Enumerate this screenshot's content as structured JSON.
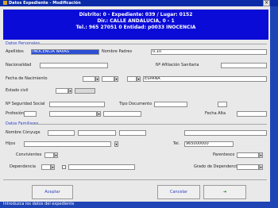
{
  "window": {
    "title": "Datos Expediente - Modificación"
  },
  "header": {
    "line1": "Distrito: 0 - Expediente: 039 / Lugar: 0152",
    "line2": "Dir.: CALLE ANDALUCIA, 0 - 1",
    "line3": "Tel.: 965 27051 0  Entidad: p0033 INOCENCIA"
  },
  "section1": {
    "title": "Datos Personales"
  },
  "row1": {
    "label_a": "Apellidos",
    "value_a": "INOCENCIA NAVAS",
    "label_b": "Nombre Padres",
    "value_b": "0.10"
  },
  "row2": {
    "label_a": "Nacionalidad",
    "value_a": "",
    "label_b": "Nº Afiliación Sanitaria",
    "value_b": ""
  },
  "row3": {
    "label_a": "Fecha de Nacimiento",
    "value_a": "",
    "field2": "",
    "field3": "",
    "value_b": "ESPAÑA"
  },
  "row4": {
    "label_a": "Estado civil",
    "value_a": "",
    "value_b": ""
  },
  "row5": {
    "label_a": "Nº Seguridad Social",
    "value_a": "",
    "label_b": "Tipo Documento",
    "value_b": "",
    "value_c": ""
  },
  "row6": {
    "label_a": "Profesión",
    "value_a": "",
    "value_b": "",
    "label_c": "Fecha Alta",
    "value_c": ""
  },
  "section2": {
    "title": "Datos Familiares"
  },
  "row7": {
    "label_a": "Nombre Cónyuge",
    "value_a": "",
    "value_b": "",
    "label_c": "",
    "value_c": ""
  },
  "row8": {
    "label_a": "Hijos",
    "value_a": "",
    "value_b": "",
    "label_c": "Tel.",
    "value_c": "965000000"
  },
  "row9": {
    "label_a": "Convivientes",
    "value_a": "",
    "label_b": "Parentesco",
    "value_b": ""
  },
  "row10": {
    "label_a": "Dependencia",
    "value_a": "",
    "value_b": "",
    "label_c": "Grado de Dependencia",
    "value_c": ""
  },
  "buttons": {
    "accept": "Aceptar",
    "cancel": "Cancelar",
    "exit": "Salir"
  },
  "status": {
    "text": "Introduzca los datos del expediente"
  }
}
